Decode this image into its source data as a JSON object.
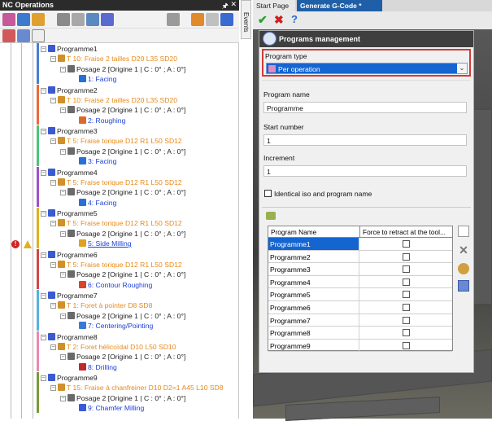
{
  "left_panel": {
    "title": "NC Operations",
    "pin": " ↕",
    "close": "✕",
    "tree": [
      {
        "program": "Programme1",
        "tool": "T 10: Fraise 2 tailles D20 L35 SD20",
        "posage": "Posage 2 [Origine 1 | C : 0° ; A : 0°]",
        "op": "1: Facing",
        "op_color": "#2a6fd6"
      },
      {
        "program": "Programme2",
        "tool": "T 10: Fraise 2 tailles D20 L35 SD20",
        "posage": "Posage 2 [Origine 1 | C : 0° ; A : 0°]",
        "op": "2: Roughing",
        "op_color": "#d96a2a"
      },
      {
        "program": "Programme3",
        "tool": "T 5: Fraise torique D12 R1 L50 SD12",
        "posage": "Posage 2 [Origine 1 | C : 0° ; A : 0°]",
        "op": "3: Facing",
        "op_color": "#2a6fd6"
      },
      {
        "program": "Programme4",
        "tool": "T 5: Fraise torique D12 R1 L50 SD12",
        "posage": "Posage 2 [Origine 1 | C : 0° ; A : 0°]",
        "op": "4: Facing",
        "op_color": "#2a6fd6"
      },
      {
        "program": "Programme5",
        "tool": "T 5: Fraise torique D12 R1 L50 SD12",
        "posage": "Posage 2 [Origine 1 | C : 0° ; A : 0°]",
        "op": "5: Side Milling",
        "op_color": "#e0a020"
      },
      {
        "program": "Programme6",
        "tool": "T 5: Fraise torique D12 R1 L50 SD12",
        "posage": "Posage 2 [Origine 1 | C : 0° ; A : 0°]",
        "op": "6: Contour Roughing",
        "op_color": "#d9442a"
      },
      {
        "program": "Programme7",
        "tool": "T 1: Foret à pointer D8 SD8",
        "posage": "Posage 2 [Origine 1 | C : 0° ; A : 0°]",
        "op": "7: Centering/Pointing",
        "op_color": "#3a7ad6"
      },
      {
        "program": "Programme8",
        "tool": "T 2: Foret hélicoïdal D10 L50 SD10",
        "posage": "Posage 2 [Origine 1 | C : 0° ; A : 0°]",
        "op": "8: Drilling",
        "op_color": "#c0282a"
      },
      {
        "program": "Programme9",
        "tool": "T 15: Fraise à chanfreiner D10 D2=1 A45 L10 SD8",
        "posage": "Posage 2 [Origine 1 | C : 0° ; A : 0°]",
        "op": "9: Chamfer Milling",
        "op_color": "#3a5ad6"
      }
    ],
    "band_colors": [
      "#4a7fd0",
      "#e86a3a",
      "#4ac47a",
      "#a052c8",
      "#e0b020",
      "#d04848",
      "#5ab0e0",
      "#e88ab0",
      "#7a9a3a"
    ]
  },
  "events_tab": "Events",
  "tabs": {
    "start": "Start Page",
    "gcode": "Generate G-Code *"
  },
  "panel": {
    "header": "Programs management",
    "program_type_label": "Program type",
    "program_type_value": "Per operation",
    "program_name_label": "Program name",
    "program_name_value": "Programme",
    "start_number_label": "Start number",
    "start_number_value": "1",
    "increment_label": "Increment",
    "increment_value": "1",
    "identical_iso_label": "Identical iso and program name",
    "grid_headers": [
      "Program Name",
      "Force to retract at the tool..."
    ],
    "grid_rows": [
      "Programme1",
      "Programme2",
      "Programme3",
      "Programme4",
      "Programme5",
      "Programme6",
      "Programme7",
      "Programme8",
      "Programme9"
    ]
  },
  "colors": {
    "accent": "#1565d0",
    "tool_text": "#e68a1a",
    "op_text": "#1b3fd6",
    "highlight_border": "#d23a3a"
  }
}
